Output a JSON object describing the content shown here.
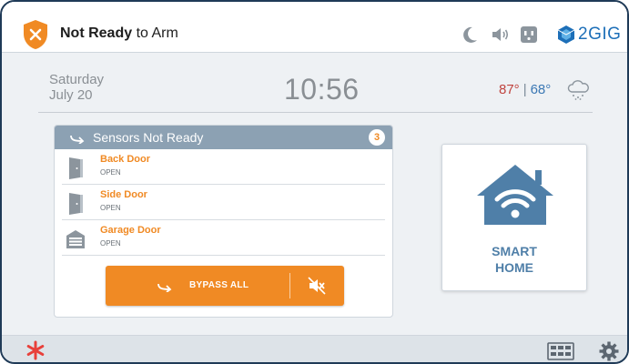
{
  "header": {
    "status_bold": "Not Ready",
    "status_rest": " to Arm",
    "brand": "2GIG",
    "icons": [
      "night-mode-icon",
      "volume-icon",
      "outlet-icon",
      "brand-logo-icon"
    ]
  },
  "datetime": {
    "day": "Saturday",
    "date": "July 20",
    "time": "10:56"
  },
  "weather": {
    "high": "87°",
    "separator": "|",
    "low": "68°",
    "icon": "snow-cloud-icon"
  },
  "sensors": {
    "title": "Sensors Not Ready",
    "count": "3",
    "items": [
      {
        "name": "Back Door",
        "state": "OPEN",
        "icon": "door-icon"
      },
      {
        "name": "Side Door",
        "state": "OPEN",
        "icon": "door-icon"
      },
      {
        "name": "Garage Door",
        "state": "OPEN",
        "icon": "garage-icon"
      }
    ],
    "bypass_label": "BYPASS ALL"
  },
  "smart_home": {
    "label": "SMART\nHOME"
  },
  "colors": {
    "accent_orange": "#f08a24",
    "header_blue_gray": "#8ca1b3",
    "brand_blue": "#1d6fb8",
    "temp_high": "#c0443f",
    "temp_low": "#3b78b4",
    "alert_red": "#e8403a"
  }
}
